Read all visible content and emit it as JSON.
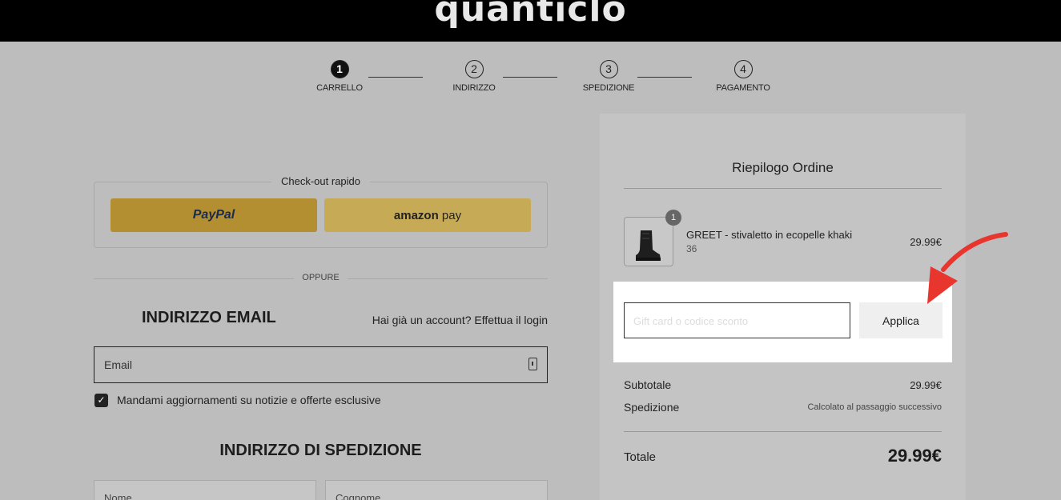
{
  "header": {
    "logo": "quanticlo"
  },
  "steps": [
    {
      "number": "1",
      "label": "CARRELLO",
      "active": true
    },
    {
      "number": "2",
      "label": "INDIRIZZO",
      "active": false
    },
    {
      "number": "3",
      "label": "SPEDIZIONE",
      "active": false
    },
    {
      "number": "4",
      "label": "PAGAMENTO",
      "active": false
    }
  ],
  "quick_checkout": {
    "title": "Check-out rapido",
    "paypal_label": "PayPal",
    "amazon_label_brand": "amazon",
    "amazon_label_suffix": "pay"
  },
  "divider": "OPPURE",
  "email_section": {
    "heading": "INDIRIZZO EMAIL",
    "login_text": "Hai già un account? Effettua il login",
    "email_placeholder": "Email",
    "newsletter_label": "Mandami aggiornamenti su notizie e offerte esclusive",
    "newsletter_checked": true
  },
  "shipping_section": {
    "heading": "INDIRIZZO DI SPEDIZIONE",
    "first_name_placeholder": "Nome",
    "last_name_placeholder": "Cognome"
  },
  "summary": {
    "title": "Riepilogo Ordine",
    "item": {
      "quantity": "1",
      "name": "GREET - stivaletto in ecopelle khaki",
      "size": "36",
      "price": "29.99€"
    },
    "discount": {
      "placeholder": "Gift card o codice sconto",
      "apply_label": "Applica"
    },
    "subtotal_label": "Subtotale",
    "subtotal_value": "29.99€",
    "shipping_label": "Spedizione",
    "shipping_value": "Calcolato al passaggio successivo",
    "total_label": "Totale",
    "total_value": "29.99€"
  },
  "colors": {
    "annotation_arrow": "#e8362f",
    "highlight": "#ffffff"
  }
}
